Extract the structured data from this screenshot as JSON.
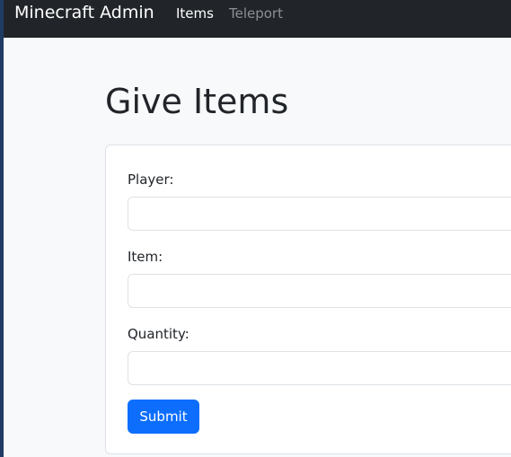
{
  "navbar": {
    "brand": "Minecraft Admin",
    "links": [
      {
        "label": "Items",
        "active": true
      },
      {
        "label": "Teleport",
        "active": false
      }
    ]
  },
  "page": {
    "title": "Give Items"
  },
  "form": {
    "fields": [
      {
        "label": "Player:",
        "value": "",
        "placeholder": ""
      },
      {
        "label": "Item:",
        "value": "",
        "placeholder": ""
      },
      {
        "label": "Quantity:",
        "value": "",
        "placeholder": ""
      }
    ],
    "submit_label": "Submit"
  },
  "colors": {
    "navbar_bg": "#212529",
    "page_bg": "#f8f9fa",
    "primary": "#0d6efd",
    "nav_active": "#ffffff",
    "nav_inactive": "#8c9096"
  }
}
